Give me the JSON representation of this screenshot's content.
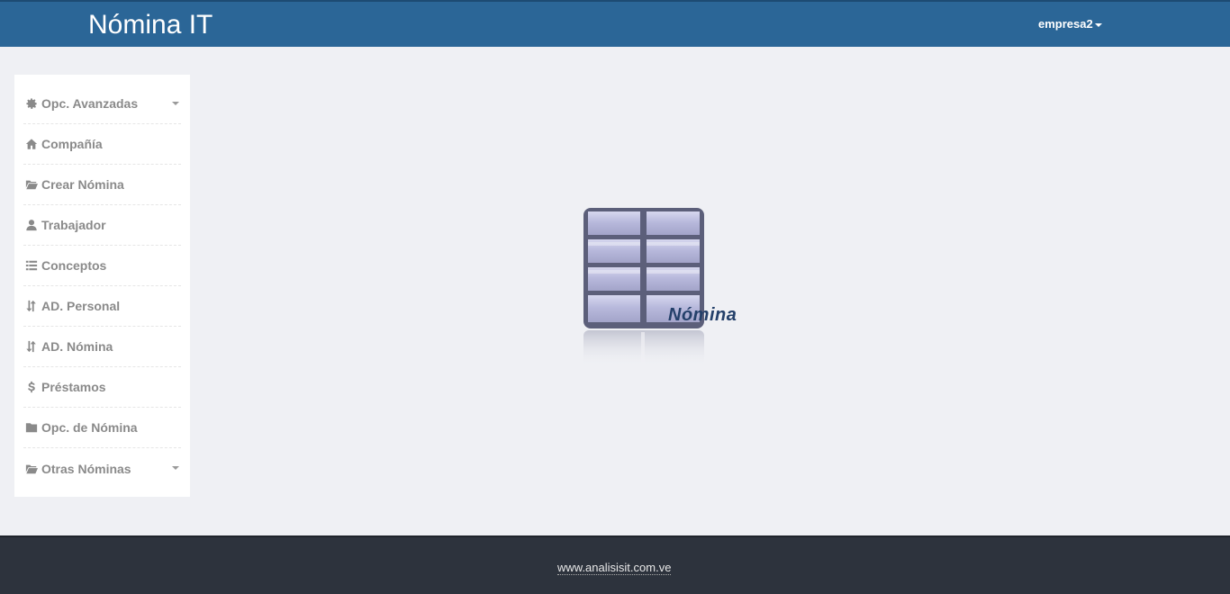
{
  "header": {
    "title": "Nómina IT",
    "user_label": "empresa2"
  },
  "sidebar": {
    "items": [
      {
        "label": "Opc. Avanzadas",
        "icon": "gear-icon",
        "has_submenu": true
      },
      {
        "label": "Compañía",
        "icon": "home-icon",
        "has_submenu": false
      },
      {
        "label": "Crear Nómina",
        "icon": "folder-open-icon",
        "has_submenu": false
      },
      {
        "label": "Trabajador",
        "icon": "user-icon",
        "has_submenu": false
      },
      {
        "label": "Conceptos",
        "icon": "list-icon",
        "has_submenu": false
      },
      {
        "label": "AD. Personal",
        "icon": "sort-icon",
        "has_submenu": false
      },
      {
        "label": "AD. Nómina",
        "icon": "sort-icon",
        "has_submenu": false
      },
      {
        "label": "Préstamos",
        "icon": "dollar-icon",
        "has_submenu": false
      },
      {
        "label": "Opc. de Nómina",
        "icon": "folder-icon",
        "has_submenu": false
      },
      {
        "label": "Otras Nóminas",
        "icon": "folder-open-icon",
        "has_submenu": true
      }
    ]
  },
  "main": {
    "logo_text": "Nómina",
    "logo_icon": "table-grid-icon"
  },
  "footer": {
    "link_text": "www.analisisit.com.ve"
  },
  "colors": {
    "header_bg": "#2b6697",
    "footer_bg": "#2d333d",
    "page_bg": "#eff0f4",
    "logo_text": "#24406a"
  }
}
